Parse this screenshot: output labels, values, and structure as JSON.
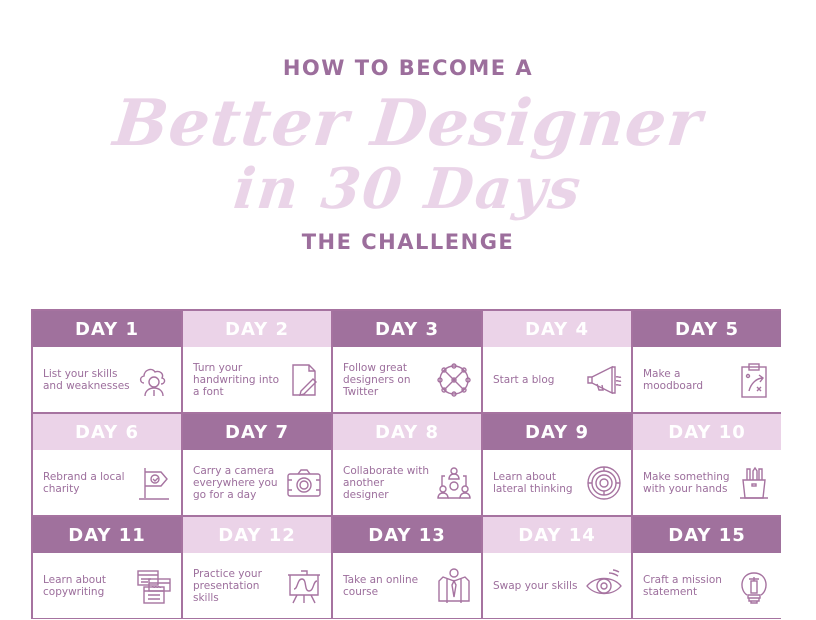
{
  "header": {
    "line1": "HOW TO BECOME A",
    "line2": "Better Designer",
    "line3": "in 30 Days",
    "line4": "THE CHALLENGE"
  },
  "colors": {
    "dark_header": "#a0719d",
    "light_header": "#ebd3e8",
    "text": "#9c6e9c",
    "border": "#a673a0"
  },
  "days": [
    {
      "label": "DAY 1",
      "task": "List your skills and weaknesses",
      "icon": "person-cloud-icon",
      "style": "dark"
    },
    {
      "label": "DAY 2",
      "task": "Turn your handwriting into a font",
      "icon": "document-pen-icon",
      "style": "light"
    },
    {
      "label": "DAY 3",
      "task": "Follow great designers on Twitter",
      "icon": "network-globe-icon",
      "style": "dark"
    },
    {
      "label": "DAY 4",
      "task": "Start a blog",
      "icon": "megaphone-icon",
      "style": "light"
    },
    {
      "label": "DAY 5",
      "task": "Make a moodboard",
      "icon": "clipboard-icon",
      "style": "dark"
    },
    {
      "label": "DAY 6",
      "task": "Rebrand a local charity",
      "icon": "flag-check-icon",
      "style": "light"
    },
    {
      "label": "DAY 7",
      "task": "Carry a camera everywhere you go for a day",
      "icon": "camera-icon",
      "style": "dark"
    },
    {
      "label": "DAY 8",
      "task": "Collaborate with another designer",
      "icon": "team-icon",
      "style": "light"
    },
    {
      "label": "DAY 9",
      "task": "Learn about lateral thinking",
      "icon": "maze-icon",
      "style": "dark"
    },
    {
      "label": "DAY 10",
      "task": "Make something with your hands",
      "icon": "pencil-cup-icon",
      "style": "light"
    },
    {
      "label": "DAY 11",
      "task": "Learn about copywriting",
      "icon": "windows-text-icon",
      "style": "dark"
    },
    {
      "label": "DAY 12",
      "task": "Practice your presentation skills",
      "icon": "presentation-board-icon",
      "style": "light"
    },
    {
      "label": "DAY 13",
      "task": "Take an online course",
      "icon": "suit-icon",
      "style": "dark"
    },
    {
      "label": "DAY 14",
      "task": "Swap your skills",
      "icon": "eye-icon",
      "style": "light"
    },
    {
      "label": "DAY 15",
      "task": "Craft a mission statement",
      "icon": "lightbulb-icon",
      "style": "dark"
    }
  ]
}
